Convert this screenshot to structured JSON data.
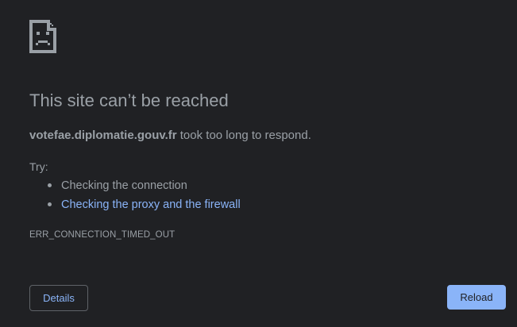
{
  "error_page": {
    "icon": "sad-page-icon",
    "title": "This site can’t be reached",
    "summary": {
      "host": "votefae.diplomatie.gouv.fr",
      "message": " took too long to respond."
    },
    "try_label": "Try:",
    "suggestions": [
      {
        "text": "Checking the connection",
        "is_link": false
      },
      {
        "text": "Checking the proxy and the firewall",
        "is_link": true
      }
    ],
    "error_code": "ERR_CONNECTION_TIMED_OUT"
  },
  "buttons": {
    "details_label": "Details",
    "reload_label": "Reload"
  },
  "colors": {
    "background": "#202124",
    "text": "#9aa0a6",
    "link": "#8ab4f8",
    "primary_button": "#8ab4f8",
    "button_border": "#5f6368"
  }
}
